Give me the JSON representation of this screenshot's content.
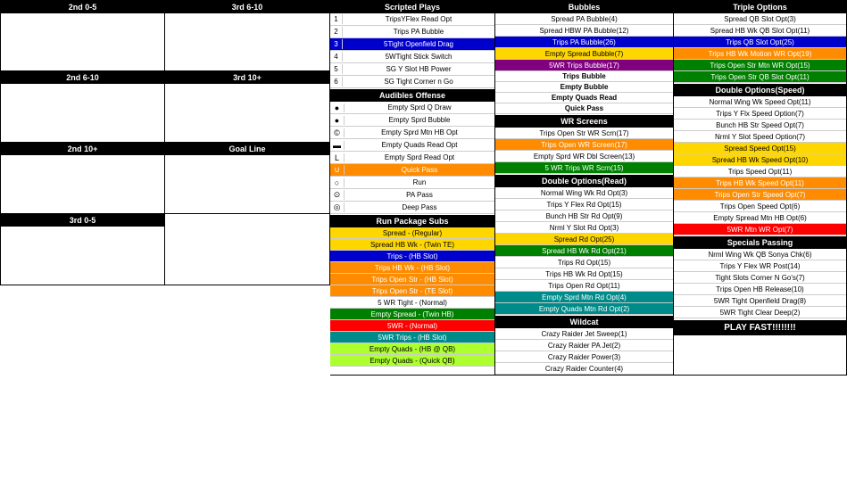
{
  "layout": {
    "left_col1_header": "2nd 0-5",
    "left_col2_header": "3rd 6-10",
    "left_col1_row2": "2nd 6-10",
    "left_col2_row2": "3rd 10+",
    "left_col1_row3": "2nd 10+",
    "left_col2_row3": "Goal Line",
    "left_col1_row4": "3rd 0-5"
  },
  "scripted_plays": {
    "header": "Scripted Plays",
    "items": [
      {
        "num": "1",
        "text": "TripsYFlex Read Opt"
      },
      {
        "num": "2",
        "text": "Trips PA Bubble"
      },
      {
        "num": "3",
        "text": "5Tight Openfield Drag"
      },
      {
        "num": "4",
        "text": "5WTight Stick Switch"
      },
      {
        "num": "5",
        "text": "SG Y Slot HB Power"
      },
      {
        "num": "6",
        "text": "SG Tight Corner n Go"
      }
    ]
  },
  "audibles": {
    "header": "Audibles Offense",
    "items": [
      {
        "icon": "circle-fill",
        "text": "Empty Sprd Q Draw"
      },
      {
        "icon": "circle-fill",
        "text": "Empty Sprd Bubble"
      },
      {
        "icon": "circle-c",
        "text": "Empty Sprd Mtn HB Opt"
      },
      {
        "icon": "rect",
        "text": "Empty Quads Read Opt"
      },
      {
        "icon": "rect-l",
        "text": "Empty Sprd Read Opt"
      },
      {
        "icon": "u-shape",
        "text": "Quick Pass"
      },
      {
        "icon": "circle-o",
        "text": "Run"
      },
      {
        "icon": "circle-d",
        "text": "PA Pass"
      },
      {
        "icon": "circle-d2",
        "text": "Deep Pass"
      }
    ]
  },
  "run_subs": {
    "header": "Run Package Subs",
    "items": [
      {
        "text": "Spread - (Regular)",
        "color": "yellow"
      },
      {
        "text": "Spread HB Wk - (Twin TE)",
        "color": "yellow"
      },
      {
        "text": "Trips - (HB Slot)",
        "color": "blue"
      },
      {
        "text": "Trips HB Wk - (HB Slot)",
        "color": "orange"
      },
      {
        "text": "Trips Open Str - (HB Slot)",
        "color": "orange"
      },
      {
        "text": "Trips Open Str - (TE Slot)",
        "color": "orange"
      },
      {
        "text": "5 WR Tight - (Normal)",
        "color": "white"
      },
      {
        "text": "Empty Spread - (Twin HB)",
        "color": "green"
      },
      {
        "text": "5WR - (Normal)",
        "color": "red"
      },
      {
        "text": "5WR Trips - (HB Slot)",
        "color": "teal"
      },
      {
        "text": "Empty Quads - (HB @ QB)",
        "color": "lime"
      },
      {
        "text": "Empty Quads - (Quick QB)",
        "color": "lime"
      }
    ]
  },
  "bubbles": {
    "header": "Bubbles",
    "items": [
      {
        "text": "Spread PA Bubble(4)",
        "color": "white"
      },
      {
        "text": "Spread HBW PA Bubble(12)",
        "color": "white"
      },
      {
        "text": "Trips PA Bubble(26)",
        "color": "blue"
      },
      {
        "text": "Empty Spread Bubble(7)",
        "color": "yellow"
      },
      {
        "text": "5WR Trips Bubble(17)",
        "color": "purple"
      }
    ],
    "trips_bubble_header": "Trips Bubble",
    "wr_screens_header": "WR Screens",
    "wr_screens": [
      {
        "text": "Trips Open Str WR Scrn(17)",
        "color": "white"
      },
      {
        "text": "Trips Open WR Screen(17)",
        "color": "orange"
      },
      {
        "text": "Empty Sprd WR Dbl Screen(13)",
        "color": "white"
      },
      {
        "text": "5 WR Trips WR Scrn(15)",
        "color": "green"
      }
    ],
    "double_read_header": "Double Options(Read)",
    "double_read": [
      {
        "text": "Normal Wing Wk Rd Opt(3)",
        "color": "white"
      },
      {
        "text": "Trips Y Flex Rd Opt(15)",
        "color": "white"
      },
      {
        "text": "Bunch HB Str Rd Opt(9)",
        "color": "white"
      },
      {
        "text": "Nrml Y Slot Rd Opt(3)",
        "color": "white"
      },
      {
        "text": "Spread Rd Opt(25)",
        "color": "yellow"
      },
      {
        "text": "Spread HB Wk Rd Opt(21)",
        "color": "green"
      },
      {
        "text": "Trips Rd Opt(15)",
        "color": "white"
      },
      {
        "text": "Trips HB Wk Rd Opt(15)",
        "color": "white"
      },
      {
        "text": "Trips Open Rd Opt(11)",
        "color": "white"
      },
      {
        "text": "Empty Sprd Mtn Rd Opt(4)",
        "color": "teal"
      },
      {
        "text": "Empty Quads Mtn Rd Opt(2)",
        "color": "teal"
      }
    ],
    "empty_bubble_header": "Empty Bubble",
    "empty_quads_header": "Empty Quads Read",
    "quick_pass_header": "Quick Pass",
    "wildcat_header": "Wildcat",
    "wildcat": [
      {
        "text": "Crazy Raider Jet Sweep(1)",
        "color": "white"
      },
      {
        "text": "Crazy Raider PA Jet(2)",
        "color": "white"
      },
      {
        "text": "Crazy Raider Power(3)",
        "color": "white"
      },
      {
        "text": "Crazy Raider Counter(4)",
        "color": "white"
      }
    ]
  },
  "triple": {
    "header": "Triple Options",
    "items": [
      {
        "text": "Spread QB Slot Opt(3)",
        "color": "white"
      },
      {
        "text": "Spread HB Wk QB Slot Opt(11)",
        "color": "white"
      },
      {
        "text": "Trips QB Slot Opt(25)",
        "color": "blue"
      },
      {
        "text": "Trips HB Wk Motion WR Opt(19)",
        "color": "orange"
      },
      {
        "text": "Trips Open Str Mtn WR Opt(15)",
        "color": "green"
      },
      {
        "text": "Trips Open Str QB Slot Opt(11)",
        "color": "green"
      }
    ],
    "double_speed_header": "Double Options(Speed)",
    "double_speed": [
      {
        "text": "Normal Wing Wk Speed Opt(11)",
        "color": "white"
      },
      {
        "text": "Trips Y Flx Speed Option(7)",
        "color": "white"
      },
      {
        "text": "Bunch HB Str Speed Opt(7)",
        "color": "white"
      },
      {
        "text": "Nrml Y Slot Speed Option(7)",
        "color": "white"
      },
      {
        "text": "Spread Speed Opt(15)",
        "color": "yellow"
      },
      {
        "text": "Spread HB Wk Speed Opt(10)",
        "color": "yellow"
      },
      {
        "text": "Trips Speed Opt(11)",
        "color": "white"
      },
      {
        "text": "Trips HB Wk Speed Opt(11)",
        "color": "orange"
      },
      {
        "text": "Trips Open Str Speed Opt(7)",
        "color": "orange"
      },
      {
        "text": "Trips Open Speed Opt(6)",
        "color": "white"
      },
      {
        "text": "Empty Spread Mtn HB Opt(6)",
        "color": "white"
      },
      {
        "text": "5WR Mtn WR Opt(7)",
        "color": "red"
      }
    ],
    "specials_header": "Specials Passing",
    "specials": [
      {
        "text": "Nrml Wing Wk QB Sonya Chk(6)",
        "color": "white"
      },
      {
        "text": "Trips Y Flex WR Post(14)",
        "color": "white"
      },
      {
        "text": "Tight Slots Corner N Go's(7)",
        "color": "white"
      },
      {
        "text": "Trips Open HB Release(10)",
        "color": "white"
      },
      {
        "text": "5WR Tight Openfield Drag(8)",
        "color": "white"
      },
      {
        "text": "5WR Tight Clear Deep(2)",
        "color": "white"
      }
    ],
    "play_fast": "PLAY FAST!!!!!!!!"
  }
}
